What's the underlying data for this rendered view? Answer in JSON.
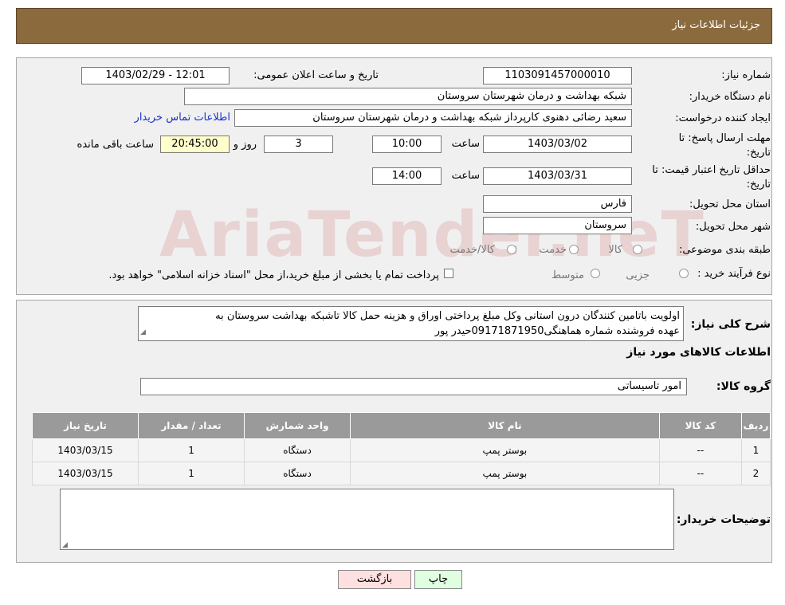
{
  "header": {
    "title": "جزئیات اطلاعات نیاز"
  },
  "form": {
    "need_number_label": "شماره نیاز:",
    "need_number": "1103091457000010",
    "announce_label": "تاریخ و ساعت اعلان عمومی:",
    "announce_value": "1403/02/29 - 12:01",
    "buyer_org_label": "نام دستگاه خریدار:",
    "buyer_org": "شبکه بهداشت و درمان شهرستان سروستان",
    "creator_label": "ایجاد کننده درخواست:",
    "creator": "سعید رضائی دهنوی کارپرداز شبکه بهداشت و درمان شهرستان سروستان",
    "contact_link": "اطلاعات تماس خریدار",
    "deadline_label_1": "مهلت ارسال پاسخ: تا",
    "deadline_label_2": "تاریخ:",
    "deadline_date": "1403/03/02",
    "time_word": "ساعت",
    "deadline_time": "10:00",
    "days_value": "3",
    "days_word": "روز و",
    "remaining_time": "20:45:00",
    "remaining_word": "ساعت باقی مانده",
    "validity_label_1": "حداقل تاریخ اعتبار قیمت: تا",
    "validity_label_2": "تاریخ:",
    "validity_date": "1403/03/31",
    "validity_time": "14:00",
    "province_label": "استان محل تحویل:",
    "province": "فارس",
    "city_label": "شهر محل تحویل:",
    "city": "سروستان",
    "category_label": "طبقه بندی موضوعی:",
    "cat_goods": "کالا",
    "cat_service": "خدمت",
    "cat_goods_service": "کالا/خدمت",
    "process_label": "نوع فرآیند خرید :",
    "proc_partial": "جزیی",
    "proc_medium": "متوسط",
    "payment_note": "پرداخت تمام یا بخشی از مبلغ خرید،از محل \"اسناد خزانه اسلامی\" خواهد بود."
  },
  "description": {
    "label": "شرح کلی نیاز:",
    "line1": "اولویت باتامین کنندگان درون استانی وکل مبلغ پرداختی اوراق و هزینه حمل کالا تاشبکه بهداشت سروستان به",
    "line2": "عهده فروشنده شماره هماهنگی09171871950حیدر پور"
  },
  "items_section": {
    "title": "اطلاعات کالاهای مورد نیاز",
    "group_label": "گروه کالا:",
    "group_value": "امور تاسیساتی",
    "columns": [
      "ردیف",
      "کد کالا",
      "نام کالا",
      "واحد شمارش",
      "تعداد / مقدار",
      "تاریخ نیاز"
    ],
    "rows": [
      {
        "row": "1",
        "code": "--",
        "name": "بوستر پمپ",
        "unit": "دستگاه",
        "qty": "1",
        "date": "1403/03/15"
      },
      {
        "row": "2",
        "code": "--",
        "name": "بوستر پمپ",
        "unit": "دستگاه",
        "qty": "1",
        "date": "1403/03/15"
      }
    ]
  },
  "notes": {
    "label": "توضیحات خریدار:",
    "value": ""
  },
  "buttons": {
    "print": "چاپ",
    "back": "بازگشت"
  },
  "watermark": "AriaTender.neT",
  "colors": {
    "header_bg": "#8b6a3e",
    "link": "#1a33cc",
    "back_btn": "#ffe0e0",
    "print_btn": "#e0ffe0"
  }
}
